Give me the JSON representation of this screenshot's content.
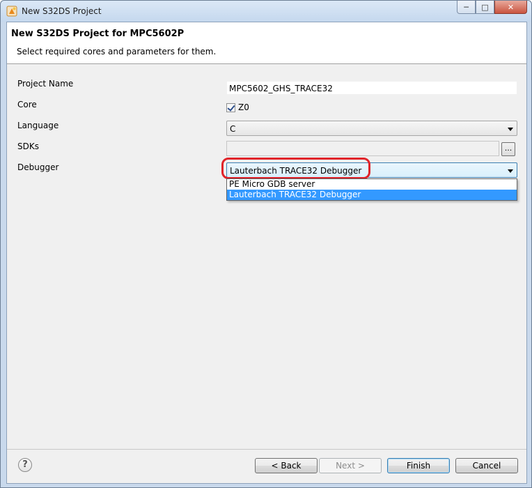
{
  "window": {
    "title": "New S32DS Project",
    "minimize_glyph": "─",
    "maximize_glyph": "□",
    "close_glyph": "✕"
  },
  "banner": {
    "title": "New S32DS Project for MPC5602P",
    "subtitle": "Select required cores and parameters for them."
  },
  "form": {
    "project_name_label": "Project Name",
    "project_name_value": "MPC5602_GHS_TRACE32",
    "core_label": "Core",
    "core_checkbox_label": "Z0",
    "core_checked": true,
    "language_label": "Language",
    "language_value": "C",
    "sdks_label": "SDKs",
    "sdks_browse_label": "...",
    "debugger_label": "Debugger",
    "debugger_value": "Lauterbach TRACE32 Debugger",
    "debugger_options": [
      "PE Micro GDB server",
      "Lauterbach TRACE32 Debugger"
    ],
    "debugger_selected_index": 1
  },
  "footer": {
    "help_glyph": "?",
    "back_label": "< Back",
    "next_label": "Next >",
    "finish_label": "Finish",
    "cancel_label": "Cancel"
  },
  "colors": {
    "selection": "#3399ff",
    "highlight_ring": "#e0242a"
  }
}
